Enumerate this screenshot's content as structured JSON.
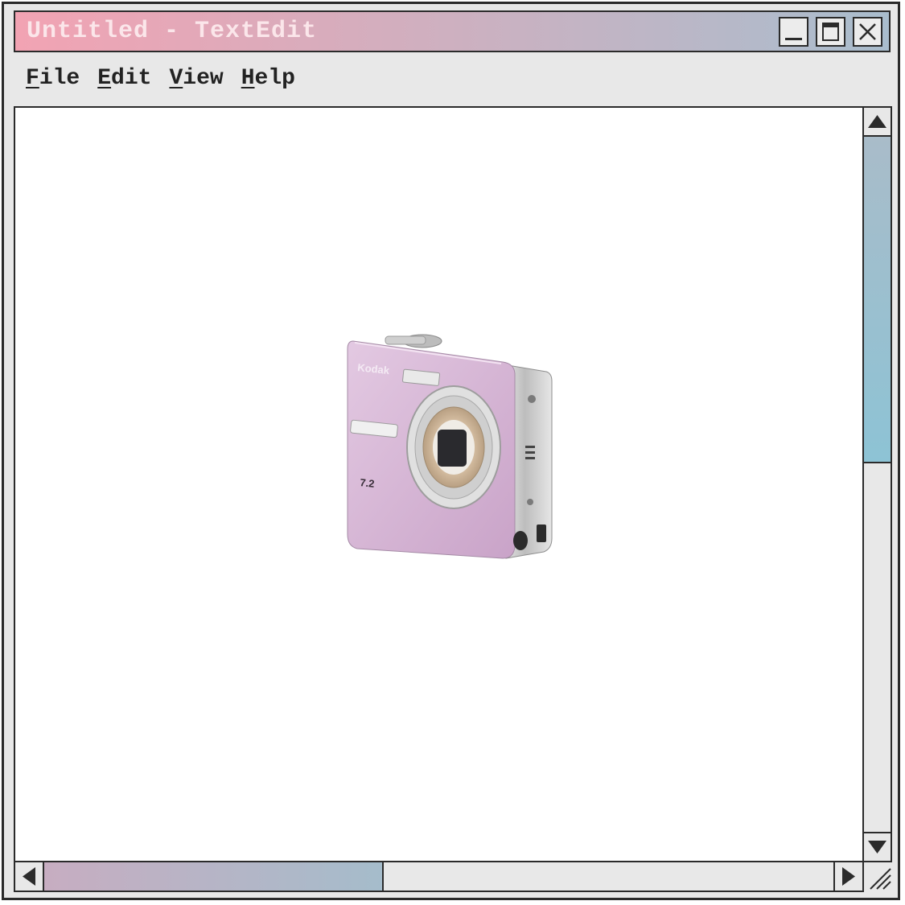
{
  "window": {
    "title": "Untitled - TextEdit",
    "title_gradient_start": "#f2a3b3",
    "title_gradient_end": "#a9bdcd"
  },
  "window_controls": {
    "minimize_icon": "minimize-icon",
    "maximize_icon": "maximize-icon",
    "close_icon": "close-icon"
  },
  "menu": [
    {
      "accel": "F",
      "rest": "ile"
    },
    {
      "accel": "E",
      "rest": "dit"
    },
    {
      "accel": "V",
      "rest": "iew"
    },
    {
      "accel": "H",
      "rest": "elp"
    }
  ],
  "document": {
    "image": {
      "subject": "lilac compact digital camera",
      "brand_text": "Kodak",
      "megapixel_text": "7.2",
      "body_color": "#d7b7d5"
    }
  },
  "scrollbars": {
    "vertical_thumb_fraction": 0.47,
    "horizontal_thumb_fraction": 0.43,
    "vertical_color": "#8dc3d5",
    "horizontal_color": "#c7adc1"
  },
  "icons": [
    "scroll-up-icon",
    "scroll-down-icon",
    "scroll-left-icon",
    "scroll-right-icon",
    "resize-grip-icon"
  ]
}
